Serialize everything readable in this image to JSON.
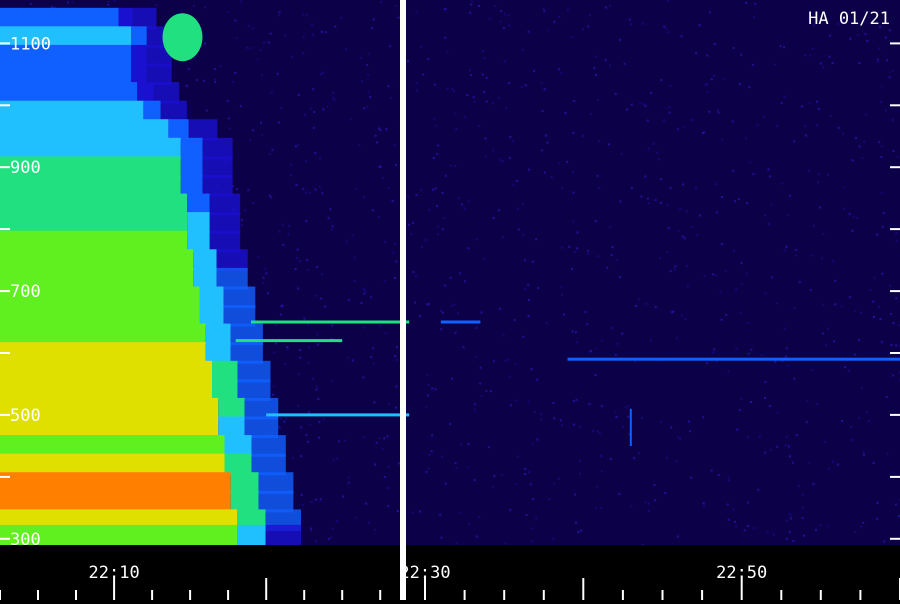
{
  "chart_data": {
    "type": "heatmap",
    "title": "HA 01/21",
    "xlabel": "",
    "ylabel": "",
    "x_tick_labels": [
      {
        "label": "22:10",
        "minutes": 10
      },
      {
        "label": "22:30",
        "minutes": 30
      },
      {
        "label": "22:50",
        "minutes": 50
      }
    ],
    "y_tick_labels": [
      {
        "label": "1100",
        "value": 1100
      },
      {
        "label": "900",
        "value": 900
      },
      {
        "label": "700",
        "value": 700
      },
      {
        "label": "500",
        "value": 500
      },
      {
        "label": "300",
        "value": 300
      }
    ],
    "x_minor_tick_step_minutes": 2.5,
    "y_tick_step": 100,
    "ylim": [
      290,
      1170
    ],
    "panels": [
      {
        "xlim_minutes": [
          2.5,
          28.8
        ]
      },
      {
        "xlim_minutes": [
          28.8,
          60.0
        ]
      }
    ],
    "burst": {
      "start_minute": 2.5,
      "colors": [
        "#0a0040",
        "#1a10d0",
        "#1060ff",
        "#20c0ff",
        "#20e080",
        "#60f020",
        "#e0e000",
        "#ff8000",
        "#ff2000"
      ],
      "rows": [
        {
          "value": 1140,
          "intensity": 0.3,
          "end_minute": 12
        },
        {
          "value": 1110,
          "intensity": 0.36,
          "end_minute": 13
        },
        {
          "value": 1080,
          "intensity": 0.3,
          "end_minute": 13
        },
        {
          "value": 1050,
          "intensity": 0.22,
          "end_minute": 13
        },
        {
          "value": 1020,
          "intensity": 0.25,
          "end_minute": 13.5
        },
        {
          "value": 990,
          "intensity": 0.32,
          "end_minute": 14
        },
        {
          "value": 960,
          "intensity": 0.34,
          "end_minute": 16
        },
        {
          "value": 930,
          "intensity": 0.42,
          "end_minute": 17
        },
        {
          "value": 900,
          "intensity": 0.46,
          "end_minute": 17
        },
        {
          "value": 870,
          "intensity": 0.5,
          "end_minute": 17
        },
        {
          "value": 840,
          "intensity": 0.52,
          "end_minute": 17.5
        },
        {
          "value": 810,
          "intensity": 0.56,
          "end_minute": 17.5
        },
        {
          "value": 780,
          "intensity": 0.58,
          "end_minute": 17.5
        },
        {
          "value": 750,
          "intensity": 0.62,
          "end_minute": 18
        },
        {
          "value": 720,
          "intensity": 0.64,
          "end_minute": 18
        },
        {
          "value": 690,
          "intensity": 0.66,
          "end_minute": 18.5
        },
        {
          "value": 660,
          "intensity": 0.64,
          "end_minute": 18.5
        },
        {
          "value": 630,
          "intensity": 0.67,
          "end_minute": 19
        },
        {
          "value": 600,
          "intensity": 0.7,
          "end_minute": 19
        },
        {
          "value": 570,
          "intensity": 0.76,
          "end_minute": 19.5
        },
        {
          "value": 540,
          "intensity": 0.78,
          "end_minute": 19.5
        },
        {
          "value": 510,
          "intensity": 0.74,
          "end_minute": 20
        },
        {
          "value": 480,
          "intensity": 0.7,
          "end_minute": 20
        },
        {
          "value": 450,
          "intensity": 0.66,
          "end_minute": 20.5
        },
        {
          "value": 420,
          "intensity": 0.8,
          "end_minute": 20.5
        },
        {
          "value": 390,
          "intensity": 0.88,
          "end_minute": 21
        },
        {
          "value": 360,
          "intensity": 0.86,
          "end_minute": 21
        },
        {
          "value": 330,
          "intensity": 0.8,
          "end_minute": 21.5
        },
        {
          "value": 305,
          "intensity": 0.62,
          "end_minute": 21.5
        }
      ],
      "features": [
        {
          "kind": "spot",
          "value": 1110,
          "minute": 14.5,
          "intensity": 0.48
        },
        {
          "kind": "line",
          "value": 650,
          "start_minute": 19,
          "end_minute": 29,
          "intensity": 0.52
        },
        {
          "kind": "line",
          "value": 620,
          "start_minute": 18,
          "end_minute": 25,
          "intensity": 0.44
        },
        {
          "kind": "line",
          "value": 500,
          "start_minute": 20,
          "end_minute": 29,
          "intensity": 0.42
        },
        {
          "kind": "line",
          "value": 650,
          "start_minute": 31,
          "end_minute": 33.5,
          "intensity": 0.3
        },
        {
          "kind": "line",
          "value": 590,
          "start_minute": 39,
          "end_minute": 60,
          "intensity": 0.26
        },
        {
          "kind": "vline",
          "minute": 43,
          "value_from": 450,
          "value_to": 510,
          "intensity": 0.28
        }
      ]
    }
  }
}
